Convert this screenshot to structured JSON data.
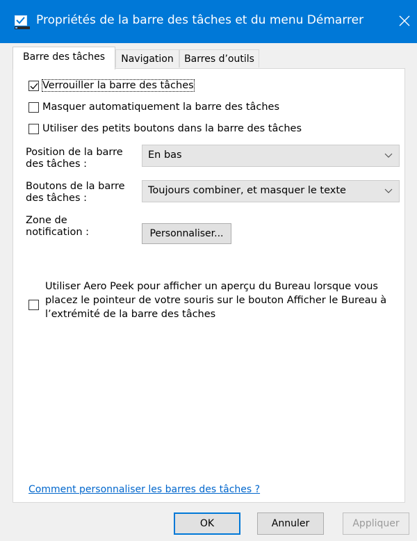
{
  "window": {
    "title": "Propriétés de la barre des tâches et du menu Démarrer",
    "title_bar_color": "#0078d7",
    "icon": "taskbar-properties-icon",
    "close_icon": "close-icon"
  },
  "tabs": [
    {
      "label": "Barre des tâches",
      "active": true
    },
    {
      "label": "Navigation",
      "active": false
    },
    {
      "label": "Barres d’outils",
      "active": false
    }
  ],
  "options": {
    "lock_taskbar": {
      "label": "Verrouiller la barre des tâches",
      "checked": true
    },
    "auto_hide": {
      "label": "Masquer automatiquement la barre des tâches",
      "checked": false
    },
    "small_buttons": {
      "label": "Utiliser des petits boutons dans la barre des tâches",
      "checked": false
    }
  },
  "position": {
    "label_line1": "Position de la barre",
    "label_line2": "des tâches :",
    "value": "En bas"
  },
  "buttons": {
    "label_line1": "Boutons de la barre",
    "label_line2": "des tâches :",
    "value": "Toujours combiner, et masquer le texte"
  },
  "notification": {
    "label_line1": "Zone de",
    "label_line2": "notification :",
    "button_label": "Personnaliser..."
  },
  "aero_peek": {
    "line1": "Utiliser Aero Peek pour afficher un aperçu du Bureau lorsque vous",
    "line2": "placez le pointeur de votre souris sur le bouton Afficher le Bureau à",
    "line3": "l’extrémité de la barre des tâches",
    "checked": false
  },
  "help_link": "Comment personnaliser les barres des tâches ?",
  "footer": {
    "ok": "OK",
    "cancel": "Annuler",
    "apply": "Appliquer"
  }
}
